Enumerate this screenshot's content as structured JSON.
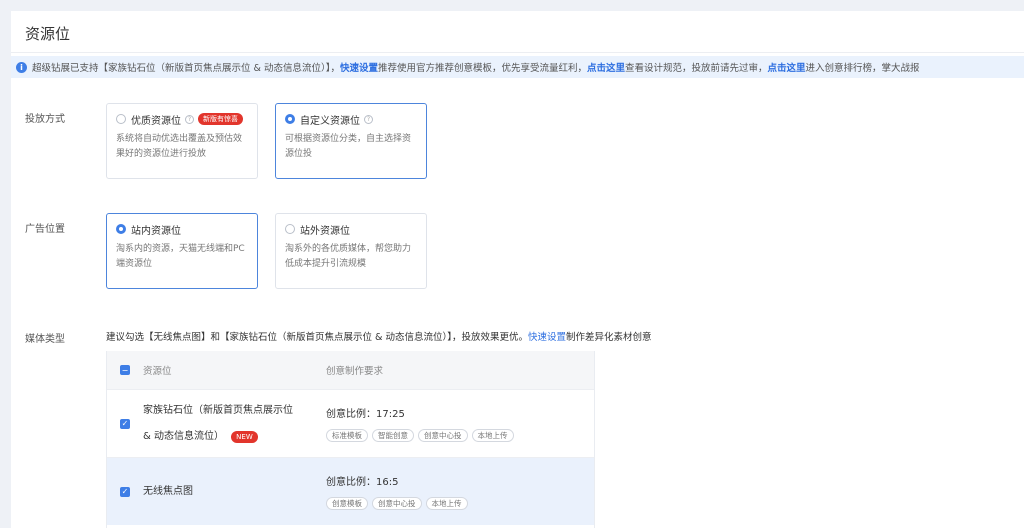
{
  "page_title": "资源位",
  "notice": {
    "part1": "超级钻展已支持【家族钻石位（新版首页焦点展示位 & 动态信息流位）】，",
    "link1": "快速设置",
    "part2": "推荐使用官方推荐创意模板，优先享受流量红利，",
    "link2": "点击这里",
    "part3": "查看设计规范，投放前请先过审，",
    "link3": "点击这里",
    "part4": "进入创意排行榜，掌大战报"
  },
  "delivery": {
    "label": "投放方式",
    "options": [
      {
        "name": "优质资源位",
        "badge": "新版有惊喜",
        "desc": "系统将自动优选出覆盖及预估效果好的资源位进行投放"
      },
      {
        "name": "自定义资源位",
        "desc": "可根据资源位分类，自主选择资源位投"
      }
    ]
  },
  "ad_position": {
    "label": "广告位置",
    "options": [
      {
        "name": "站内资源位",
        "desc": "淘系内的资源，天猫无线端和PC端资源位"
      },
      {
        "name": "站外资源位",
        "desc": "淘系外的各优质媒体，帮您助力低成本提升引流规模"
      }
    ]
  },
  "media": {
    "label": "媒体类型",
    "tip_part1": "建议勾选【无线焦点图】和【家族钻石位（新版首页焦点展示位 & 动态信息流位）】，投放效果更优。",
    "tip_link": "快速设置",
    "tip_part2": "制作差异化素材创意"
  },
  "table": {
    "headers": {
      "resource": "资源位",
      "spec": "创意制作要求"
    },
    "rows": [
      {
        "name_line1": "家族钻石位（新版首页焦点展示位",
        "name_line2": "& 动态信息流位）",
        "badge": "NEW",
        "spec": "创意比例：17:25",
        "tags": [
          "标准模板",
          "智能创意",
          "创意中心投",
          "本地上传"
        ]
      },
      {
        "name_line1": "无线焦点图",
        "spec": "创意比例：16:5",
        "tags": [
          "创意模板",
          "创意中心投",
          "本地上传"
        ]
      }
    ]
  },
  "colors": {
    "accent": "#3e7ee6",
    "notice_bg": "#eaf2fd",
    "hot_badge": "#e2352c"
  }
}
